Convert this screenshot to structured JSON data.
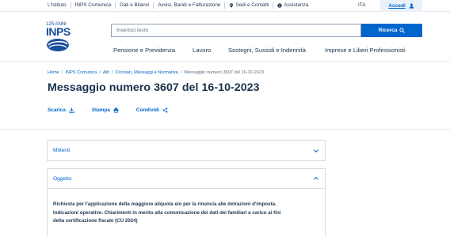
{
  "topbar": {
    "nav": [
      "L'Istituto",
      "INPS Comunica",
      "Dati e Bilanci",
      "Avvisi, Bandi e Fatturazione",
      "Sedi e Contatti",
      "Assistenza"
    ],
    "language": "ITA",
    "login_label": "Accedi"
  },
  "logo": {
    "anni": "125 ANNI",
    "name": "INPS"
  },
  "search": {
    "placeholder": "Inserisci testo",
    "button_label": "Ricerca"
  },
  "main_nav": [
    "Pensione e Previdenza",
    "Lavoro",
    "Sostegni, Sussidi e Indennità",
    "Imprese e Liberi Professionisti"
  ],
  "breadcrumb": [
    "Home",
    "INPS Comunica",
    "Atti",
    "Circolari, Messaggi e Normativa",
    "Messaggio numero 3607 del 16-10-2023"
  ],
  "page": {
    "title": "Messaggio numero 3607 del 16-10-2023",
    "actions": [
      "Scarica",
      "Stampa",
      "Condividi"
    ]
  },
  "accordions": [
    {
      "label": "Mittenti",
      "expanded": false
    },
    {
      "label": "Oggetto",
      "expanded": true,
      "body": [
        "Richiesta per l'applicazione della maggiore aliquota e/o per la rinuncia alle detrazioni d'imposta.",
        "Indicazioni operative. Chiarimenti in merito alla comunicazione dei dati dei familiari a carico ai fini",
        "della certificazione fiscale (CU 2024)"
      ]
    }
  ],
  "colors": {
    "brand": "#0066cc",
    "text": "#17324d",
    "login_bg": "#eaf1fb",
    "border": "#d4dbe3"
  },
  "icons": [
    "map-pin-icon",
    "info-icon",
    "user-icon",
    "search-icon",
    "download-icon",
    "print-icon",
    "share-icon",
    "chevron-down-icon",
    "chevron-up-icon"
  ]
}
